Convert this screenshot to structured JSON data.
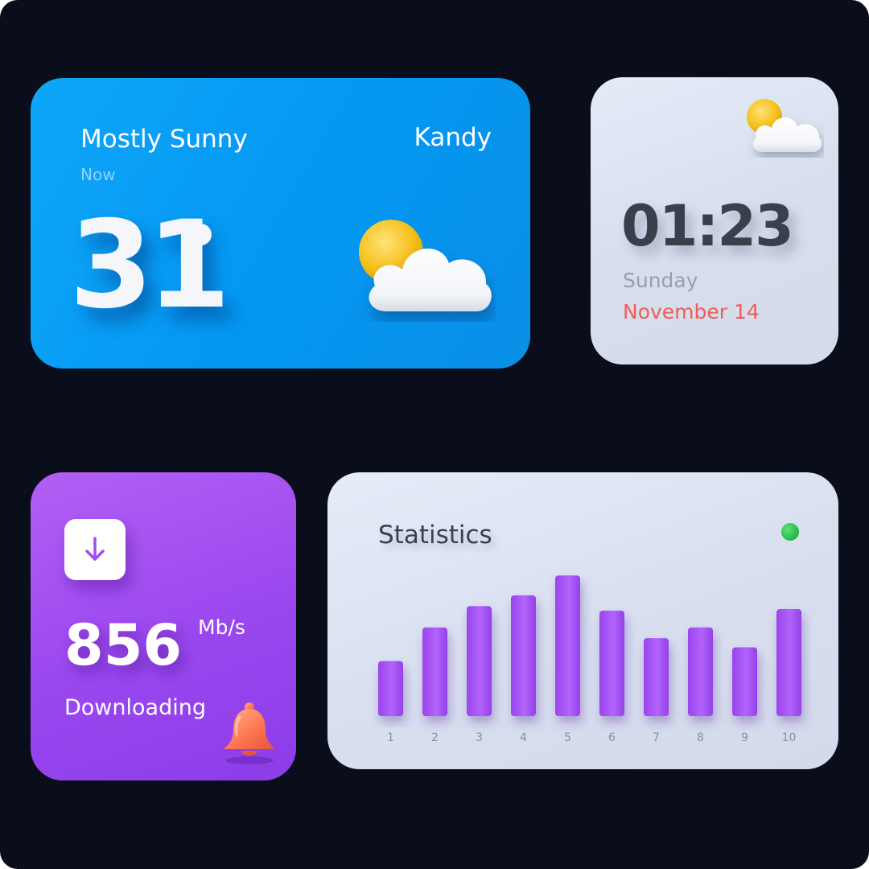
{
  "weather": {
    "condition": "Mostly Sunny",
    "city": "Kandy",
    "time_label": "Now",
    "temperature": "31",
    "icon": "partly-cloudy-icon"
  },
  "clock": {
    "time": "01:23",
    "day": "Sunday",
    "date": "November 14",
    "icon": "partly-cloudy-icon"
  },
  "download": {
    "value": "856",
    "unit": "Mb/s",
    "label": "Downloading",
    "button_icon": "download-arrow-icon",
    "bell_icon": "bell-icon"
  },
  "stats": {
    "title": "Statistics",
    "status_color": "#2ecc4f",
    "chart_data": {
      "type": "bar",
      "categories": [
        "1",
        "2",
        "3",
        "4",
        "5",
        "6",
        "7",
        "8",
        "9",
        "10"
      ],
      "values": [
        3.6,
        5.8,
        7.2,
        7.9,
        9.2,
        6.9,
        5.1,
        5.8,
        4.5,
        7.0
      ],
      "ylim": [
        0,
        10
      ],
      "grid": false,
      "bar_color": "#a855f7"
    }
  },
  "colors": {
    "background": "#0a0e1a",
    "weather_card": "#0a9cf4",
    "download_card": "#9b48ef",
    "date_accent": "#f15d55"
  }
}
